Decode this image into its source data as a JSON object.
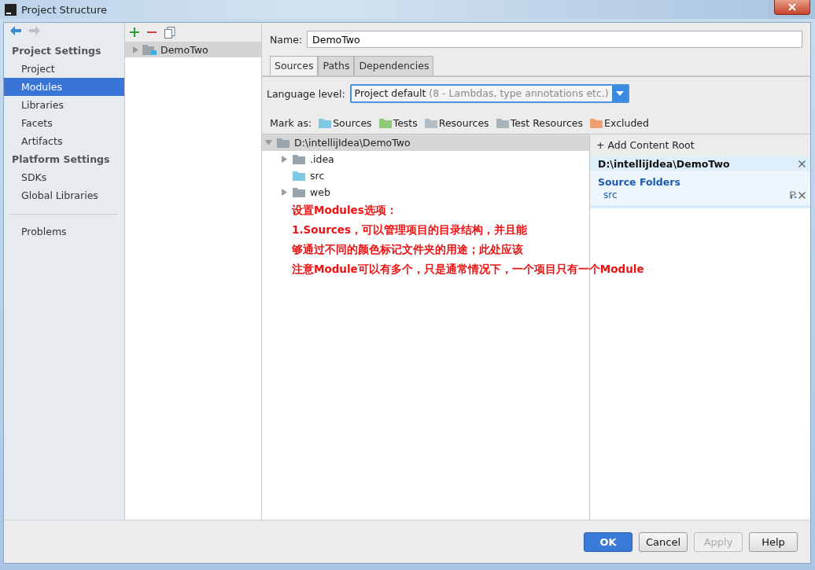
{
  "window": {
    "title": "Project Structure"
  },
  "sidebar": {
    "sections": [
      {
        "title": "Project Settings",
        "items": [
          {
            "label": "Project",
            "selected": false
          },
          {
            "label": "Modules",
            "selected": true
          },
          {
            "label": "Libraries",
            "selected": false
          },
          {
            "label": "Facets",
            "selected": false
          },
          {
            "label": "Artifacts",
            "selected": false
          }
        ]
      },
      {
        "title": "Platform Settings",
        "items": [
          {
            "label": "SDKs",
            "selected": false
          },
          {
            "label": "Global Libraries",
            "selected": false
          }
        ]
      }
    ],
    "footer_items": [
      {
        "label": "Problems",
        "selected": false
      }
    ]
  },
  "modules": {
    "items": [
      {
        "label": "DemoTwo",
        "selected": true,
        "expanded": false
      }
    ]
  },
  "name_field": {
    "label": "Name:",
    "value": "DemoTwo"
  },
  "tabs": [
    {
      "label": "Sources",
      "selected": true
    },
    {
      "label": "Paths",
      "selected": false
    },
    {
      "label": "Dependencies",
      "selected": false
    }
  ],
  "language_level": {
    "label": "Language level:",
    "value": "Project default",
    "hint": "(8 - Lambdas, type annotations etc.)"
  },
  "mark_as": {
    "label": "Mark as:",
    "items": [
      {
        "label": "Sources",
        "color": "#7ec8e3"
      },
      {
        "label": "Tests",
        "color": "#8fc97a"
      },
      {
        "label": "Resources",
        "color": "#b4bcc4"
      },
      {
        "label": "Test Resources",
        "color": "#a8b4bc"
      },
      {
        "label": "Excluded",
        "color": "#f0a070"
      }
    ]
  },
  "tree": [
    {
      "label": "D:\\intellijIdea\\DemoTwo",
      "expanded": true,
      "selected": true,
      "kind": "plain",
      "children": [
        {
          "label": ".idea",
          "expanded": false,
          "selected": false,
          "kind": "plain"
        },
        {
          "label": "src",
          "selected": false,
          "kind": "source"
        },
        {
          "label": "web",
          "expanded": false,
          "selected": false,
          "kind": "plain"
        }
      ]
    }
  ],
  "annotation": [
    "设置Modules选项：",
    "1.Sources，可以管理项目的目录结构，并且能",
    "够通过不同的颜色标记文件夹的用途；此处应该",
    "注意Module可以有多个，只是通常情况下，一个项目只有一个Module"
  ],
  "content_roots": {
    "add_label": "+ Add Content Root",
    "roots": [
      {
        "path": "D:\\intellijIdea\\DemoTwo",
        "groups": [
          {
            "title": "Source Folders",
            "folders": [
              "src"
            ]
          }
        ]
      }
    ]
  },
  "buttons": [
    {
      "label": "OK",
      "kind": "default",
      "disabled": false
    },
    {
      "label": "Cancel",
      "kind": "normal",
      "disabled": false
    },
    {
      "label": "Apply",
      "kind": "normal",
      "disabled": true
    },
    {
      "label": "Help",
      "kind": "normal",
      "disabled": false
    }
  ]
}
